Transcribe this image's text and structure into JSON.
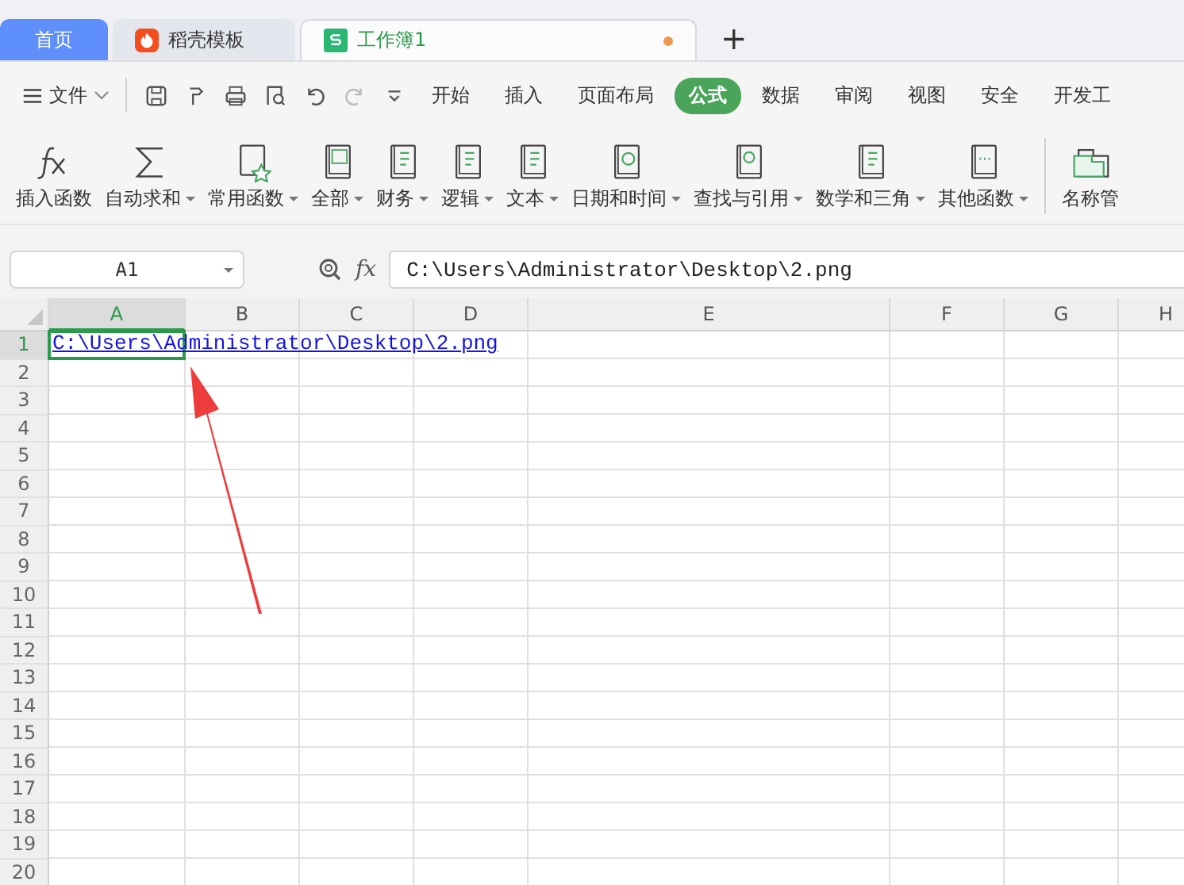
{
  "doc_tabs": [
    {
      "label": "首页",
      "kind": "home",
      "selected": false,
      "unsaved": false
    },
    {
      "label": "稻壳模板",
      "kind": "template",
      "selected": false,
      "unsaved": false
    },
    {
      "label": "工作簿1",
      "kind": "sheet",
      "selected": true,
      "unsaved": true
    }
  ],
  "new_tab": "+",
  "menu": {
    "file": "文件",
    "tabs": [
      {
        "label": "开始",
        "selected": false
      },
      {
        "label": "插入",
        "selected": false
      },
      {
        "label": "页面布局",
        "selected": false
      },
      {
        "label": "公式",
        "selected": true
      },
      {
        "label": "数据",
        "selected": false
      },
      {
        "label": "审阅",
        "selected": false
      },
      {
        "label": "视图",
        "selected": false
      },
      {
        "label": "安全",
        "selected": false
      },
      {
        "label": "开发工",
        "selected": false
      }
    ]
  },
  "ribbon": [
    {
      "label": "插入函数",
      "kind": "fx",
      "dropdown": false
    },
    {
      "label": "自动求和",
      "kind": "sigma",
      "dropdown": true
    },
    {
      "label": "常用函数",
      "kind": "star",
      "dropdown": true
    },
    {
      "label": "全部",
      "kind": "fxbook",
      "dropdown": true
    },
    {
      "label": "财务",
      "kind": "book",
      "dropdown": true
    },
    {
      "label": "逻辑",
      "kind": "book",
      "dropdown": true
    },
    {
      "label": "文本",
      "kind": "book",
      "dropdown": true
    },
    {
      "label": "日期和时间",
      "kind": "clock",
      "dropdown": true
    },
    {
      "label": "查找与引用",
      "kind": "search",
      "dropdown": true
    },
    {
      "label": "数学和三角",
      "kind": "book",
      "dropdown": true
    },
    {
      "label": "其他函数",
      "kind": "dots",
      "dropdown": true
    },
    {
      "label": "名称管",
      "kind": "folder",
      "dropdown": false
    }
  ],
  "formula_bar": {
    "name_box": "A1",
    "fx": "fx",
    "value": "C:\\Users\\Administrator\\Desktop\\2.png"
  },
  "sheet": {
    "columns": [
      {
        "label": "A",
        "selected": true
      },
      {
        "label": "B",
        "selected": false
      },
      {
        "label": "C",
        "selected": false
      },
      {
        "label": "D",
        "selected": false
      },
      {
        "label": "E",
        "selected": false
      },
      {
        "label": "F",
        "selected": false
      },
      {
        "label": "G",
        "selected": false
      },
      {
        "label": "H",
        "selected": false
      }
    ],
    "rows": [
      {
        "label": "1",
        "selected": true
      },
      {
        "label": "2",
        "selected": false
      },
      {
        "label": "3",
        "selected": false
      },
      {
        "label": "4",
        "selected": false
      },
      {
        "label": "5",
        "selected": false
      },
      {
        "label": "6",
        "selected": false
      },
      {
        "label": "7",
        "selected": false
      },
      {
        "label": "8",
        "selected": false
      },
      {
        "label": "9",
        "selected": false
      },
      {
        "label": "10",
        "selected": false
      },
      {
        "label": "11",
        "selected": false
      },
      {
        "label": "12",
        "selected": false
      },
      {
        "label": "13",
        "selected": false
      },
      {
        "label": "14",
        "selected": false
      },
      {
        "label": "15",
        "selected": false
      },
      {
        "label": "16",
        "selected": false
      },
      {
        "label": "17",
        "selected": false
      },
      {
        "label": "18",
        "selected": false
      },
      {
        "label": "19",
        "selected": false
      },
      {
        "label": "20",
        "selected": false
      }
    ],
    "cell": {
      "text": "C:\\Users\\Administrator\\Desktop\\2.png",
      "kind": "link",
      "selected": true
    }
  }
}
